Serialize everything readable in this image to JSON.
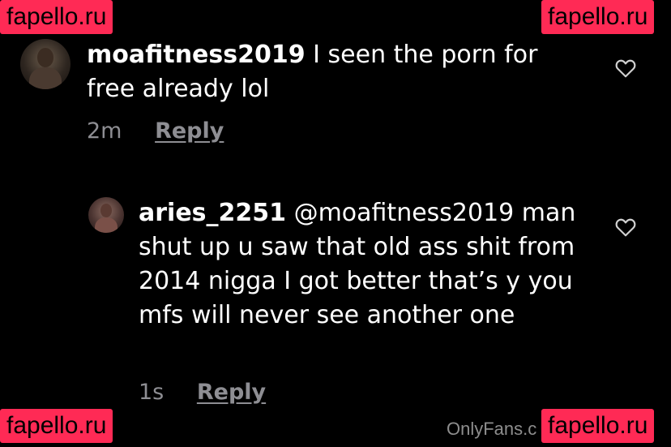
{
  "comments": [
    {
      "username": "moafitness2019",
      "text": " I seen the porn for free already lol",
      "time": "2m",
      "reply_label": "Reply"
    },
    {
      "username": "aries_2251",
      "text": " @moafitness2019 man shut up u saw that old ass shit from 2014 nigga I got better that’s y you mfs will never see another one",
      "time": "1s",
      "reply_label": "Reply"
    }
  ],
  "watermark": {
    "text": "fapello.ru",
    "color": "#ff2a55"
  },
  "footer": {
    "text": "OnlyFans.c"
  },
  "icons": {
    "like": "heart-outline-icon"
  },
  "colors": {
    "background": "#000000",
    "meta": "#8e8e93",
    "text": "#ffffff"
  }
}
